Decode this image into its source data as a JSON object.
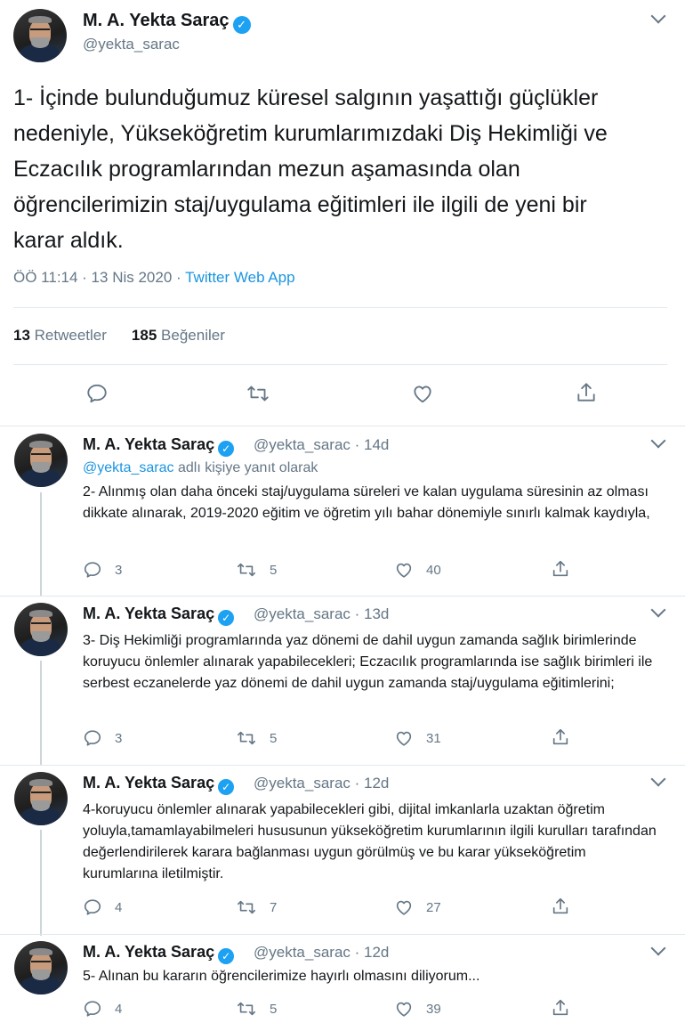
{
  "main_tweet": {
    "author_name": "M. A. Yekta Saraç",
    "verified_mark": "✓",
    "handle": "@yekta_sarac",
    "text": "1- İçinde bulunduğumuz küresel salgının yaşattığı güçlükler nedeniyle, Yükseköğretim kurumlarımızdaki Diş Hekimliği ve Eczacılık programlarından mezun aşamasında olan öğrencilerimizin staj/uygulama eğitimleri ile ilgili de yeni bir karar aldık.",
    "time_date": "ÖÖ 11:14 · 13 Nis 2020 · ",
    "source": "Twitter Web App",
    "retweets_count": "13",
    "retweets_label": "Retweetler",
    "likes_count": "185",
    "likes_label": "Beğeniler",
    "icons": [
      "reply-icon",
      "retweet-icon",
      "like-icon",
      "share-icon"
    ]
  },
  "replies": [
    {
      "author_name": "M. A. Yekta Saraç",
      "verified_mark": "✓",
      "handle_time": "@yekta_sarac · 14d",
      "reply_to_link": "@yekta_sarac",
      "reply_to_suffix": " adlı kişiye yanıt olarak",
      "text": "2- Alınmış olan daha önceki staj/uygulama süreleri ve kalan uygulama süresinin az olması dikkate alınarak, 2019-2020 eğitim ve öğretim yılı bahar dönemiyle sınırlı kalmak kaydıyla,",
      "replies": "3",
      "retweets": "5",
      "likes": "40"
    },
    {
      "author_name": "M. A. Yekta Saraç",
      "verified_mark": "✓",
      "handle_time": "@yekta_sarac · 13d",
      "text": "3- Diş Hekimliği programlarında yaz dönemi de dahil uygun zamanda sağlık birimlerinde koruyucu önlemler alınarak yapabilecekleri; Eczacılık programlarında ise sağlık birimleri ile serbest eczanelerde yaz dönemi de dahil uygun zamanda staj/uygulama eğitimlerini;",
      "replies": "3",
      "retweets": "5",
      "likes": "31"
    },
    {
      "author_name": "M. A. Yekta Saraç",
      "verified_mark": "✓",
      "handle_time": "@yekta_sarac · 12d",
      "text": "4-koruyucu önlemler alınarak yapabilecekleri gibi, dijital imkanlarla uzaktan öğretim yoluyla,tamamlayabilmeleri hususunun yükseköğretim kurumlarının ilgili kurulları tarafından değerlendirilerek karara bağlanması uygun görülmüş ve bu karar yükseköğretim kurumlarına iletilmiştir.",
      "replies": "4",
      "retweets": "7",
      "likes": "27"
    },
    {
      "author_name": "M. A. Yekta Saraç",
      "verified_mark": "✓",
      "handle_time": "@yekta_sarac · 12d",
      "text": "5- Alınan bu kararın öğrencilerimize hayırlı olmasını diliyorum...",
      "replies": "4",
      "retweets": "5",
      "likes": "39"
    }
  ],
  "colors": {
    "accent": "#1da1f2",
    "link": "#1b95e0",
    "muted": "#657786",
    "text": "#14171a",
    "divider": "#e1e8ed"
  }
}
